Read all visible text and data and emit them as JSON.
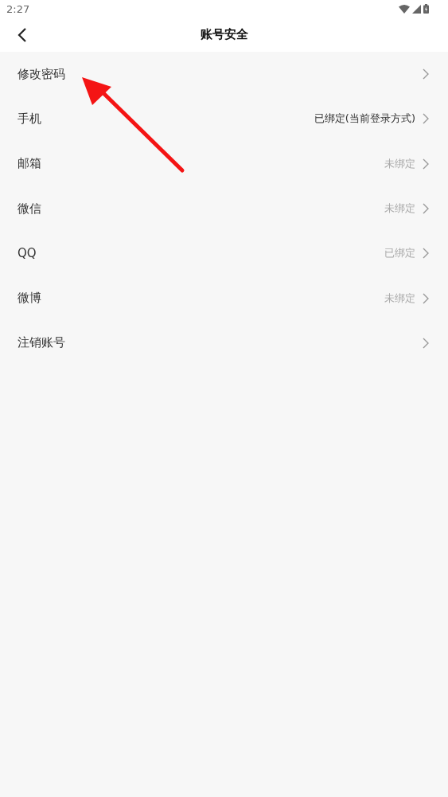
{
  "status_bar": {
    "time": "2:27"
  },
  "header": {
    "title": "账号安全"
  },
  "items": [
    {
      "label": "修改密码"
    },
    {
      "label": "手机",
      "value": "已绑定(当前登录方式)",
      "current": true
    },
    {
      "label": "邮箱",
      "value": "未绑定",
      "current": false
    },
    {
      "label": "微信",
      "value": "未绑定",
      "current": false
    },
    {
      "label": "QQ",
      "value": "已绑定",
      "current": false
    },
    {
      "label": "微博",
      "value": "未绑定",
      "current": false
    },
    {
      "label": "注销账号"
    }
  ]
}
